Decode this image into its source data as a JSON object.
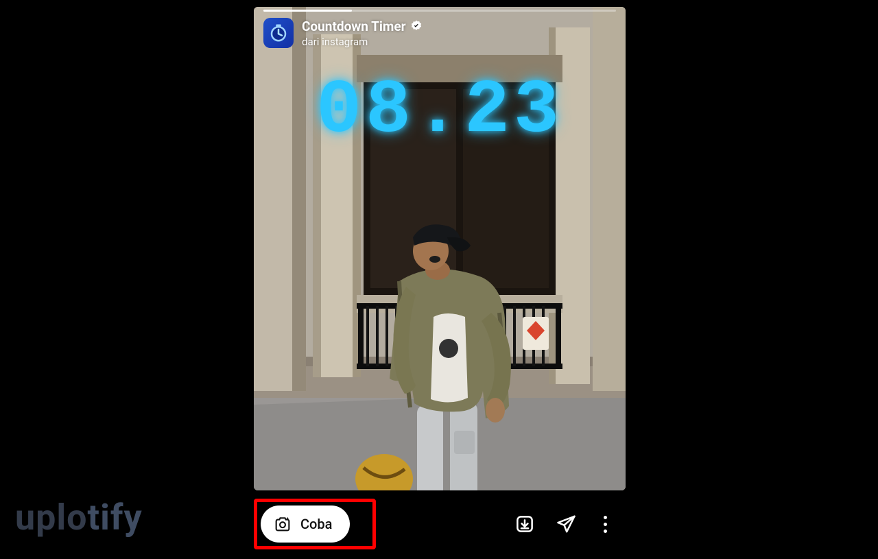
{
  "header": {
    "effect_name": "Countdown Timer",
    "subtitle": "dari instagram"
  },
  "timer": {
    "display": "08.23"
  },
  "actions": {
    "try_label": "Coba"
  },
  "watermark": {
    "part1": "uplo",
    "part2": "tify"
  },
  "colors": {
    "timer": "#2bc6ff",
    "highlight": "#ff0000"
  }
}
